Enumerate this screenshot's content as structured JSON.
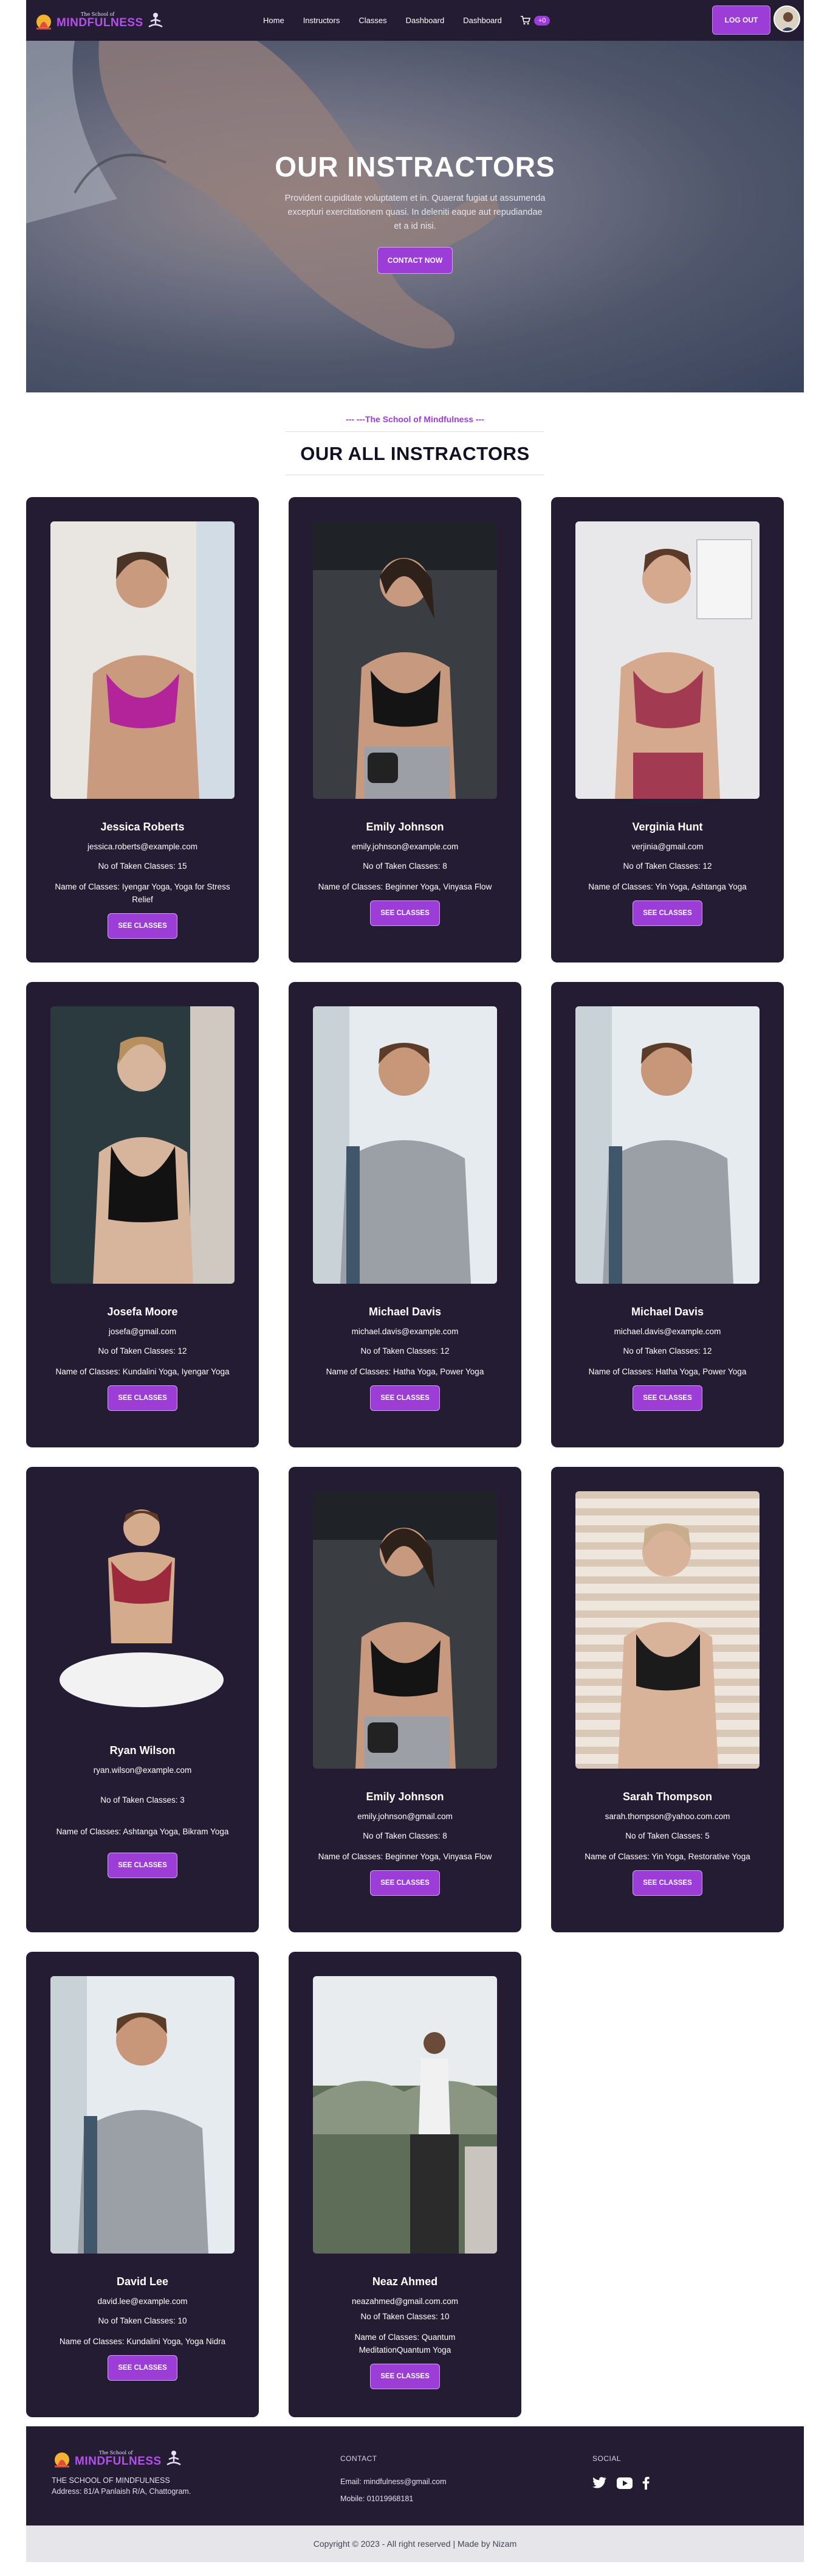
{
  "nav": {
    "logo_small": "The School of",
    "logo_big": "MINDFULNESS",
    "links": [
      "Home",
      "Instructors",
      "Classes",
      "Dashboard",
      "Dashboard"
    ],
    "cart_count": "+0",
    "logout_label": "LOG OUT"
  },
  "hero": {
    "title": "OUR INSTRACTORS",
    "text": "Provident cupiditate voluptatem et in. Quaerat fugiat ut assumenda excepturi exercitationem quasi. In deleniti eaque aut repudiandae et a id nisi.",
    "button": "CONTACT NOW"
  },
  "section": {
    "subtitle": "--- ---The School of Mindfulness ---",
    "title": "OUR ALL INSTRACTORS"
  },
  "instructors": [
    {
      "name": "Jessica Roberts",
      "email": "jessica.roberts@example.com",
      "taken": "No of Taken Classes: 15",
      "classes": "Name of Classes: Iyengar Yoga, Yoga for Stress Relief",
      "button": "SEE CLASSES"
    },
    {
      "name": "Emily Johnson",
      "email": "emily.johnson@example.com",
      "taken": "No of Taken Classes: 8",
      "classes": "Name of Classes: Beginner Yoga, Vinyasa Flow",
      "button": "SEE CLASSES"
    },
    {
      "name": "Verginia Hunt",
      "email": "verjinia@gmail.com",
      "taken": "No of Taken Classes: 12",
      "classes": "Name of Classes: Yin Yoga, Ashtanga Yoga",
      "button": "SEE CLASSES"
    },
    {
      "name": "Josefa Moore",
      "email": "josefa@gmail.com",
      "taken": "No of Taken Classes: 12",
      "classes": "Name of Classes: Kundalini Yoga, Iyengar Yoga",
      "button": "SEE CLASSES"
    },
    {
      "name": "Michael Davis",
      "email": "michael.davis@example.com",
      "taken": "No of Taken Classes: 12",
      "classes": "Name of Classes: Hatha Yoga, Power Yoga",
      "button": "SEE CLASSES"
    },
    {
      "name": "Michael Davis",
      "email": "michael.davis@example.com",
      "taken": "No of Taken Classes: 12",
      "classes": "Name of Classes: Hatha Yoga, Power Yoga",
      "button": "SEE CLASSES"
    },
    {
      "name": "Ryan Wilson",
      "email": "ryan.wilson@example.com",
      "taken": "No of Taken Classes: 3",
      "classes": "Name of Classes: Ashtanga Yoga, Bikram Yoga",
      "button": "SEE CLASSES"
    },
    {
      "name": "Emily Johnson",
      "email": "emily.johnson@gmail.com",
      "taken": "No of Taken Classes: 8",
      "classes": "Name of Classes: Beginner Yoga, Vinyasa Flow",
      "button": "SEE CLASSES"
    },
    {
      "name": "Sarah Thompson",
      "email": "sarah.thompson@yahoo.com.com",
      "taken": "No of Taken Classes: 5",
      "classes": "Name of Classes: Yin Yoga, Restorative Yoga",
      "button": "SEE CLASSES"
    },
    {
      "name": "David Lee",
      "email": "david.lee@example.com",
      "taken": "No of Taken Classes: 10",
      "classes": "Name of Classes: Kundalini Yoga, Yoga Nidra",
      "button": "SEE CLASSES"
    },
    {
      "name": "Neaz Ahmed",
      "email": "neazahmed@gmail.com.com",
      "taken": "No of Taken Classes: 10",
      "classes": "Name of Classes: Quantum MeditationQuantum Yoga",
      "button": "SEE CLASSES"
    }
  ],
  "footer": {
    "logo_small": "The School of",
    "logo_big": "MINDFULNESS",
    "school_name": "THE SCHOOL OF MINDFULNESS",
    "address": "Address: 81/A Panlaish R/A, Chattogram.",
    "contact_head": "CONTACT",
    "email": "Email: mindfulness@gmail.com",
    "mobile": "Mobile: 01019968181",
    "social_head": "SOCIAL",
    "copyright": "Copyright © 2023 - All right reserved | Made by Nizam"
  },
  "colors": {
    "dark": "#241c33",
    "accent": "#9b3dd6"
  }
}
